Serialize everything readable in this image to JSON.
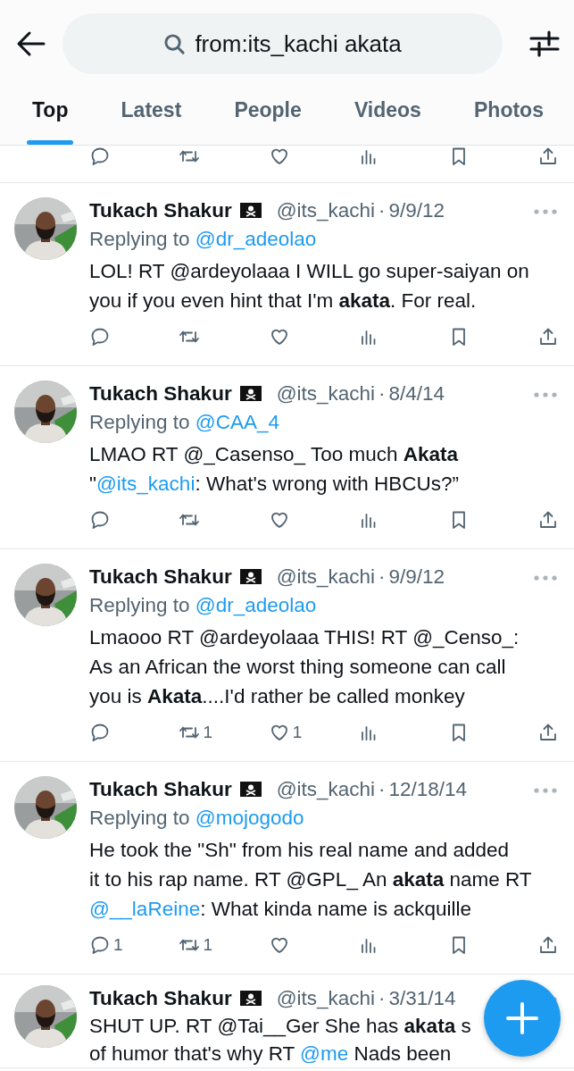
{
  "header": {
    "search": {
      "value": "from:its_kachi akata"
    }
  },
  "tabs": [
    {
      "label": "Top",
      "selected": true
    },
    {
      "label": "Latest",
      "selected": false
    },
    {
      "label": "People",
      "selected": false
    },
    {
      "label": "Videos",
      "selected": false
    },
    {
      "label": "Photos",
      "selected": false
    }
  ],
  "top_actions": [
    {
      "kind": "reply"
    },
    {
      "kind": "retweet"
    },
    {
      "kind": "like"
    },
    {
      "kind": "views"
    },
    {
      "kind": "bookmark"
    },
    {
      "kind": "share"
    }
  ],
  "tweets": [
    {
      "name": "Tukach Shakur",
      "handle": "@its_kachi",
      "separator": "·",
      "date": "9/9/12",
      "replying_label": "Replying to",
      "replying_to": "@dr_adeolao",
      "lines": [
        [
          {
            "kind": "text",
            "text": "LOL! RT @ardeyolaaa I WILL go super-saiyan on"
          }
        ],
        [
          {
            "kind": "text",
            "text": "you if you even hint that I'm "
          },
          {
            "kind": "bold",
            "text": "akata"
          },
          {
            "kind": "text",
            "text": ". For real."
          }
        ]
      ],
      "actions": [
        {
          "kind": "reply"
        },
        {
          "kind": "retweet"
        },
        {
          "kind": "like"
        },
        {
          "kind": "views"
        },
        {
          "kind": "bookmark"
        },
        {
          "kind": "share"
        }
      ]
    },
    {
      "name": "Tukach Shakur",
      "handle": "@its_kachi",
      "separator": "·",
      "date": "8/4/14",
      "replying_label": "Replying to",
      "replying_to": "@CAA_4",
      "lines": [
        [
          {
            "kind": "text",
            "text": "LMAO RT @_Casenso_ Too much "
          },
          {
            "kind": "bold",
            "text": "Akata"
          }
        ],
        [
          {
            "kind": "text",
            "text": "\""
          },
          {
            "kind": "mention",
            "text": "@its_kachi"
          },
          {
            "kind": "text",
            "text": ": What's wrong with HBCUs?”"
          }
        ]
      ],
      "actions": [
        {
          "kind": "reply"
        },
        {
          "kind": "retweet"
        },
        {
          "kind": "like"
        },
        {
          "kind": "views"
        },
        {
          "kind": "bookmark"
        },
        {
          "kind": "share"
        }
      ]
    },
    {
      "name": "Tukach Shakur",
      "handle": "@its_kachi",
      "separator": "·",
      "date": "9/9/12",
      "replying_label": "Replying to",
      "replying_to": "@dr_adeolao",
      "lines": [
        [
          {
            "kind": "text",
            "text": "Lmaooo RT @ardeyolaaa THIS! RT @_Censo_:"
          }
        ],
        [
          {
            "kind": "text",
            "text": "As an African the worst thing someone can call"
          }
        ],
        [
          {
            "kind": "text",
            "text": "you is "
          },
          {
            "kind": "bold",
            "text": "Akata"
          },
          {
            "kind": "text",
            "text": "....I'd rather be called monkey"
          }
        ]
      ],
      "actions": [
        {
          "kind": "reply"
        },
        {
          "kind": "retweet",
          "count": "1"
        },
        {
          "kind": "like",
          "count": "1"
        },
        {
          "kind": "views"
        },
        {
          "kind": "bookmark"
        },
        {
          "kind": "share"
        }
      ]
    },
    {
      "name": "Tukach Shakur",
      "handle": "@its_kachi",
      "separator": "·",
      "date": "12/18/14",
      "replying_label": "Replying to",
      "replying_to": "@mojogodo",
      "lines": [
        [
          {
            "kind": "text",
            "text": "He took the \"Sh\" from his real name and added"
          }
        ],
        [
          {
            "kind": "text",
            "text": "it to his rap name. RT @GPL_ An "
          },
          {
            "kind": "bold",
            "text": "akata"
          },
          {
            "kind": "text",
            "text": " name RT"
          }
        ],
        [
          {
            "kind": "mention",
            "text": "@__laReine"
          },
          {
            "kind": "text",
            "text": ": What kinda name is ackquille"
          }
        ]
      ],
      "actions": [
        {
          "kind": "reply",
          "count": "1"
        },
        {
          "kind": "retweet",
          "count": "1"
        },
        {
          "kind": "like"
        },
        {
          "kind": "views"
        },
        {
          "kind": "bookmark"
        },
        {
          "kind": "share"
        }
      ]
    },
    {
      "name": "Tukach Shakur",
      "handle": "@its_kachi",
      "separator": "·",
      "date": "3/31/14",
      "lines": [
        [
          {
            "kind": "text",
            "text": "SHUT UP. RT @Tai__Ger She has "
          },
          {
            "kind": "bold",
            "text": "akata"
          },
          {
            "kind": "text",
            "text": " s"
          }
        ],
        [
          {
            "kind": "text",
            "text": "of humor that's why RT "
          },
          {
            "kind": "mention",
            "text": "@me"
          },
          {
            "kind": "text",
            "text": " Nads been"
          }
        ]
      ]
    }
  ]
}
